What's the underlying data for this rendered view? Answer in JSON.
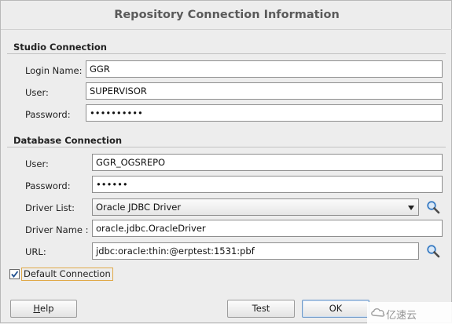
{
  "dialog": {
    "title": "Repository Connection Information"
  },
  "studio_connection": {
    "heading": "Studio Connection",
    "login_name_label": "Login Name:",
    "login_name_value": "GGR",
    "user_label": "User:",
    "user_value": "SUPERVISOR",
    "password_label": "Password:",
    "password_mask": "••••••••••"
  },
  "database_connection": {
    "heading": "Database Connection",
    "user_label": "User:",
    "user_value": "GGR_OGSREPO",
    "password_label": "Password:",
    "password_mask": "••••••",
    "driver_list_label": "Driver List:",
    "driver_list_value": "Oracle JDBC Driver",
    "driver_name_label": "Driver Name :",
    "driver_name_value": "oracle.jdbc.OracleDriver",
    "url_label": "URL:",
    "url_value": "jdbc:oracle:thin:@erptest:1531:pbf"
  },
  "default_connection": {
    "label": "Default Connection",
    "checked": true
  },
  "buttons": {
    "help_mnemonic": "H",
    "help_rest": "elp",
    "test": "Test",
    "ok": "OK"
  },
  "watermark": {
    "text": "亿速云"
  },
  "icons": {
    "driver_search": "magnifier-icon",
    "url_search": "magnifier-icon",
    "checkmark": "checkmark-icon"
  },
  "colors": {
    "dialog_background": "#ededed",
    "focus_outline": "#e0a948",
    "default_button_border": "#6f9ac9",
    "magnifier_lens": "#3b7dc4"
  }
}
